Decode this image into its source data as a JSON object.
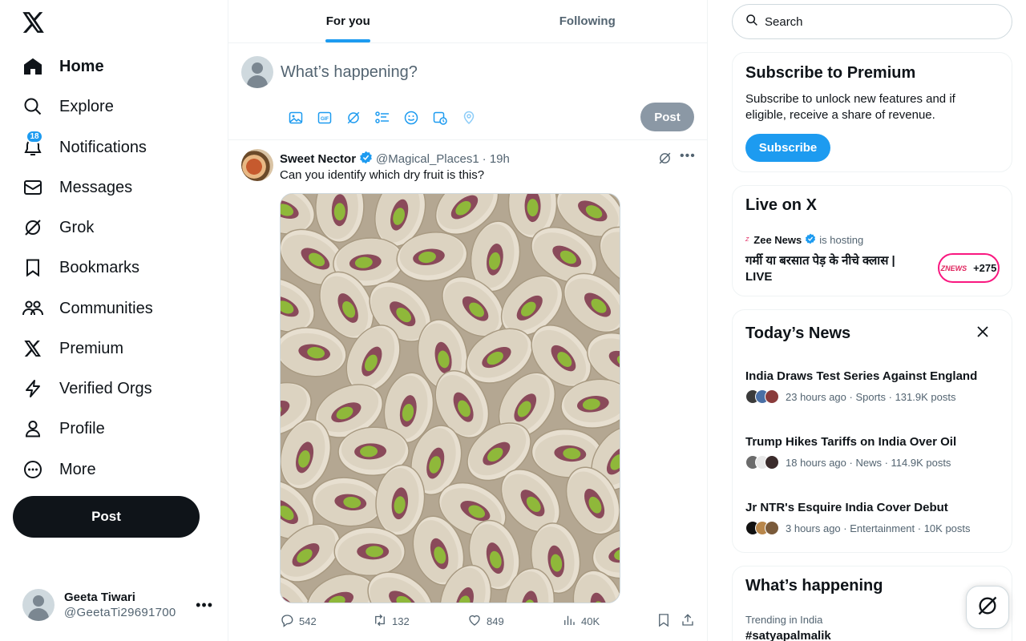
{
  "nav": {
    "items": [
      {
        "label": "Home",
        "icon": "home-icon"
      },
      {
        "label": "Explore",
        "icon": "search-icon"
      },
      {
        "label": "Notifications",
        "icon": "bell-icon",
        "badge": "18"
      },
      {
        "label": "Messages",
        "icon": "envelope-icon"
      },
      {
        "label": "Grok",
        "icon": "grok-icon"
      },
      {
        "label": "Bookmarks",
        "icon": "bookmark-icon"
      },
      {
        "label": "Communities",
        "icon": "people-icon"
      },
      {
        "label": "Premium",
        "icon": "x-logo-icon"
      },
      {
        "label": "Verified Orgs",
        "icon": "lightning-icon"
      },
      {
        "label": "Profile",
        "icon": "person-icon"
      },
      {
        "label": "More",
        "icon": "more-circle-icon"
      }
    ],
    "post_label": "Post"
  },
  "account": {
    "name": "Geeta Tiwari",
    "handle": "@GeetaTi29691700"
  },
  "tabs": [
    {
      "label": "For you"
    },
    {
      "label": "Following"
    }
  ],
  "composer": {
    "placeholder": "What’s happening?",
    "post_label": "Post"
  },
  "tweet": {
    "name": "Sweet Nector",
    "handle": "@Magical_Places1",
    "time": "· 19h",
    "text": "Can you identify which dry fruit is this?",
    "replies": "542",
    "reposts": "132",
    "likes": "849",
    "views": "40K"
  },
  "right": {
    "search_placeholder": "Search",
    "premium": {
      "title": "Subscribe to Premium",
      "desc": "Subscribe to unlock new features and if eligible, receive a share of revenue.",
      "button": "Subscribe"
    },
    "live": {
      "title": "Live on X",
      "host": "Zee News",
      "hosting": "is hosting",
      "broadcast": "गर्मी या बरसात पेड़ के नीचे क्लास | LIVE",
      "listeners": "+275",
      "logo_text": "ZNEWS"
    },
    "news": {
      "title": "Today’s News",
      "items": [
        {
          "title": "India Draws Test Series Against England",
          "meta": "23 hours ago · Sports · 131.9K posts"
        },
        {
          "title": "Trump Hikes Tariffs on India Over Oil",
          "meta": "18 hours ago · News · 114.9K posts"
        },
        {
          "title": "Jr NTR's Esquire India Cover Debut",
          "meta": "3 hours ago · Entertainment · 10K posts"
        }
      ]
    },
    "happening": {
      "title": "What’s happening",
      "trend_context": "Trending in India",
      "trend_tag": "#satyapalmalik"
    }
  },
  "colors": {
    "accent": "#1d9bf0",
    "text": "#0f1419",
    "muted": "#536471",
    "live_pink": "#f91880"
  }
}
